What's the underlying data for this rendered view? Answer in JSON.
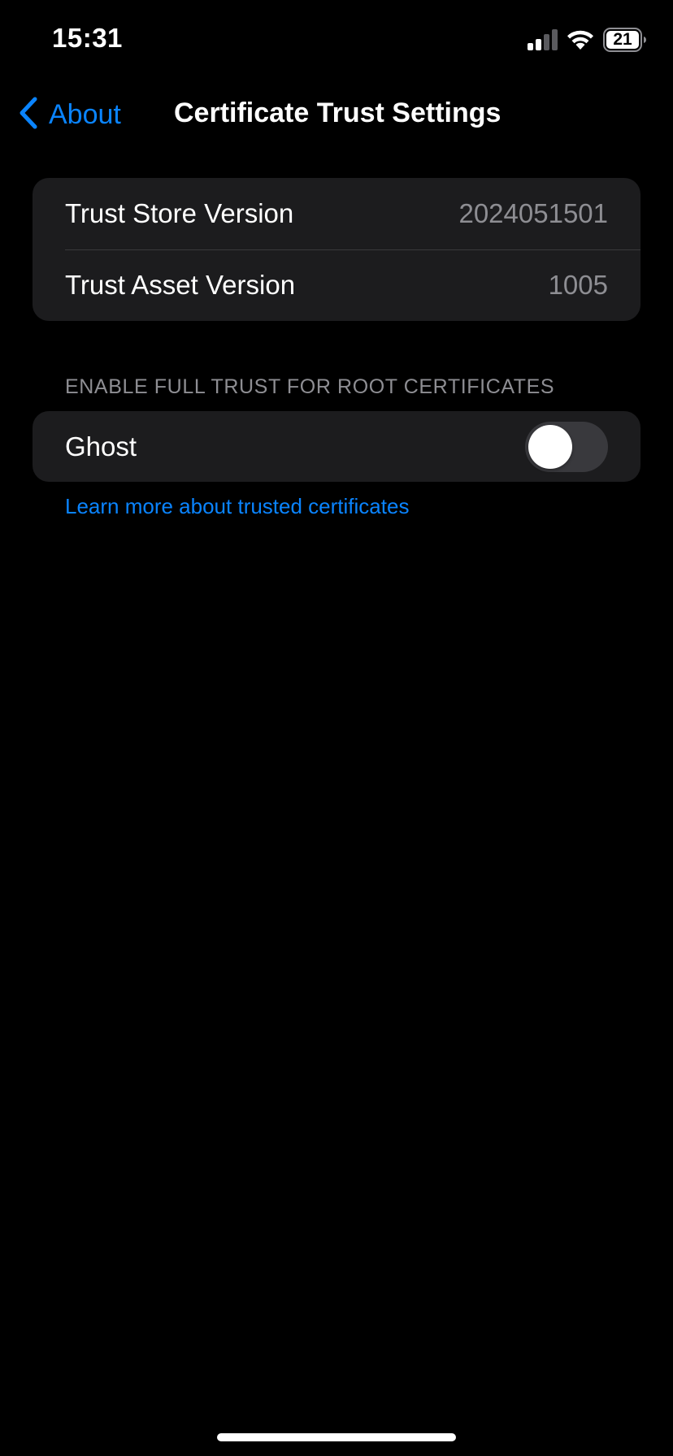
{
  "status_bar": {
    "time": "15:31",
    "battery_level": "21",
    "signal_icon": "cellular-signal-icon",
    "wifi_icon": "wifi-icon",
    "battery_icon": "battery-icon"
  },
  "nav": {
    "back_label": "About",
    "back_icon": "chevron-left-icon",
    "title": "Certificate Trust Settings"
  },
  "versions": {
    "trust_store_label": "Trust Store Version",
    "trust_store_value": "2024051501",
    "trust_asset_label": "Trust Asset Version",
    "trust_asset_value": "1005"
  },
  "root_trust": {
    "section_header": "ENABLE FULL TRUST FOR ROOT CERTIFICATES",
    "items": [
      {
        "label": "Ghost",
        "enabled": false
      }
    ],
    "learn_more": "Learn more about trusted certificates"
  },
  "colors": {
    "background": "#000000",
    "cell_background": "#1c1c1e",
    "accent": "#0a84ff",
    "secondary_text": "#8e8e93",
    "toggle_off": "#39393d"
  }
}
